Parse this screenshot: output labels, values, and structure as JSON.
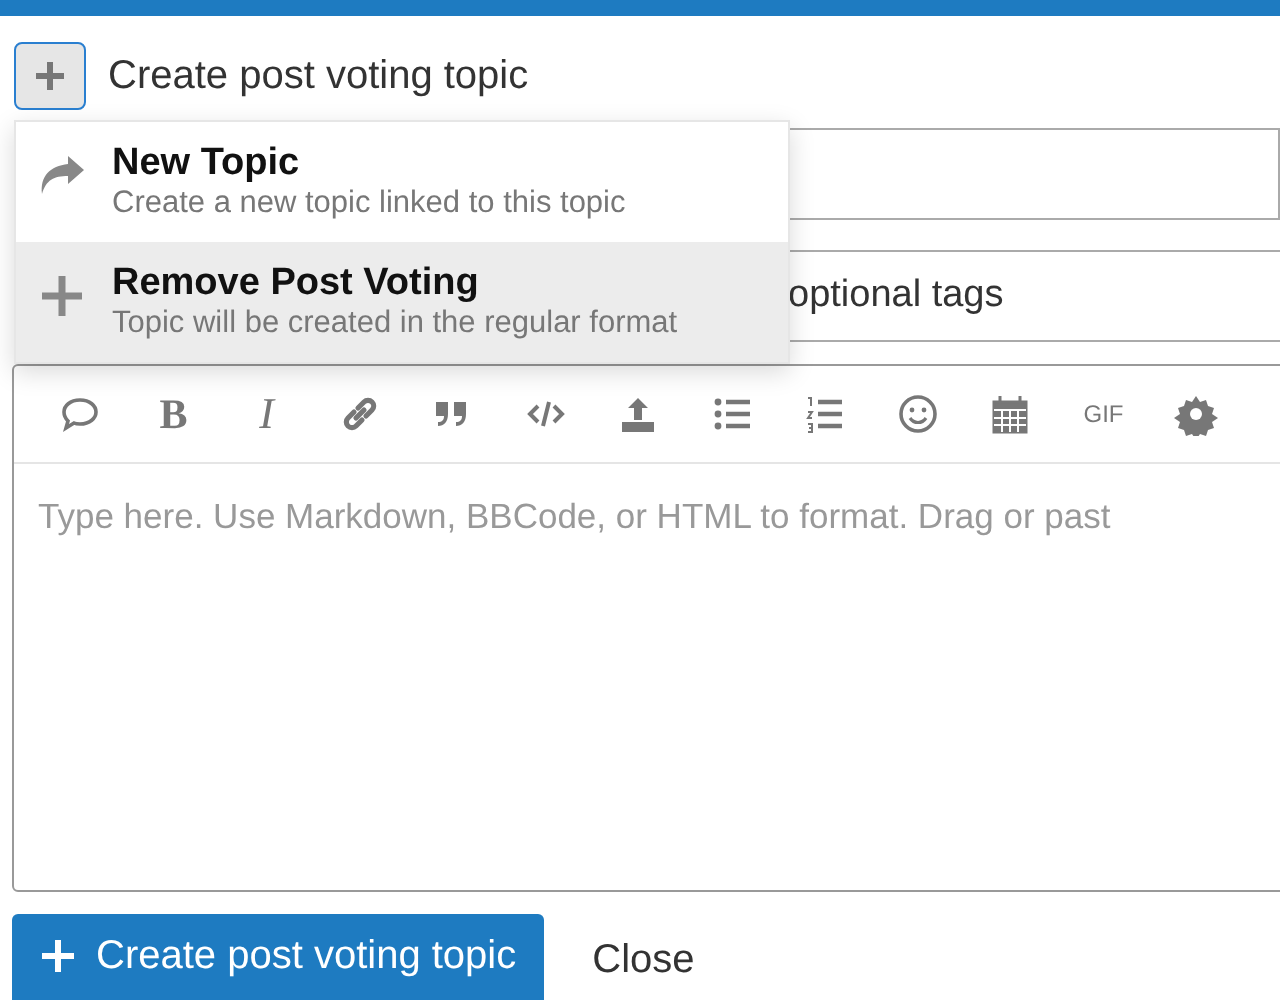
{
  "header": {
    "title": "Create post voting topic"
  },
  "menu": [
    {
      "title": "New Topic",
      "description": "Create a new topic linked to this topic",
      "kind": "reply",
      "selected": false
    },
    {
      "title": "Remove Post Voting",
      "description": "Topic will be created in the regular format",
      "kind": "plus",
      "selected": true
    }
  ],
  "tags": {
    "placeholder": "optional tags"
  },
  "toolbar": [
    {
      "kind": "icon"
    },
    {
      "kind": "bold",
      "label": "B"
    },
    {
      "kind": "italic",
      "label": "I"
    },
    {
      "kind": "icon"
    },
    {
      "kind": "icon"
    },
    {
      "kind": "icon"
    },
    {
      "kind": "icon"
    },
    {
      "kind": "icon"
    },
    {
      "kind": "icon"
    },
    {
      "kind": "icon"
    },
    {
      "kind": "icon"
    },
    {
      "kind": "text",
      "label": "GIF"
    },
    {
      "kind": "icon"
    }
  ],
  "editor": {
    "placeholder": "Type here. Use Markdown, BBCode, or HTML to format. Drag or past"
  },
  "buttons": {
    "primary": "Create post voting topic",
    "secondary": "Close"
  }
}
